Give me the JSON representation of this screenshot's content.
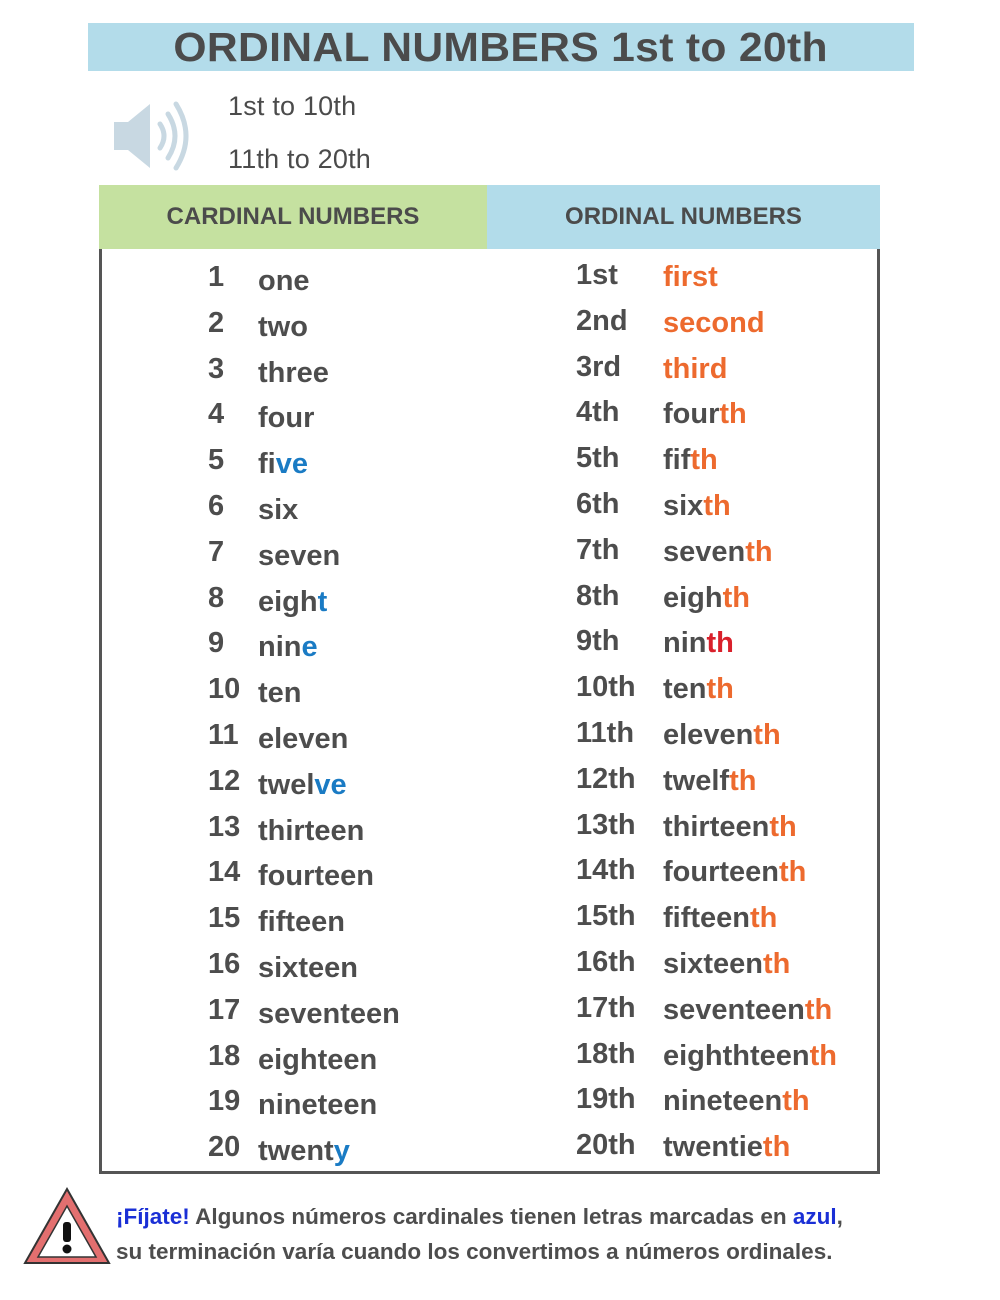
{
  "title": "ORDINAL NUMBERS 1st to 20th",
  "audio": {
    "icon": "speaker-icon",
    "links": [
      "1st to 10th",
      "11th to 20th"
    ]
  },
  "table": {
    "headers": {
      "cardinal": "CARDINAL NUMBERS",
      "ordinal": "ORDINAL NUMBERS"
    },
    "header_colors": {
      "cardinal": "#c5e1a0",
      "ordinal": "#b2dcea"
    },
    "highlight_colors": {
      "blue": "#1a7bc4",
      "orange": "#ed6a2e",
      "red": "#d9202b"
    },
    "rows": [
      {
        "c_num": "1",
        "c_base": "one",
        "c_hl": "",
        "o_num": "1st",
        "o_base": "",
        "o_hl": "first",
        "o_hl_color": "orange"
      },
      {
        "c_num": "2",
        "c_base": "two",
        "c_hl": "",
        "o_num": "2nd",
        "o_base": "",
        "o_hl": "second",
        "o_hl_color": "orange"
      },
      {
        "c_num": "3",
        "c_base": "three",
        "c_hl": "",
        "o_num": "3rd",
        "o_base": "",
        "o_hl": "third",
        "o_hl_color": "orange"
      },
      {
        "c_num": "4",
        "c_base": "four",
        "c_hl": "",
        "o_num": "4th",
        "o_base": "four",
        "o_hl": "th",
        "o_hl_color": "orange"
      },
      {
        "c_num": "5",
        "c_base": "fi",
        "c_hl": "ve",
        "o_num": "5th",
        "o_base": "fif",
        "o_hl": "th",
        "o_hl_color": "orange"
      },
      {
        "c_num": "6",
        "c_base": "six",
        "c_hl": "",
        "o_num": "6th",
        "o_base": "six",
        "o_hl": "th",
        "o_hl_color": "orange"
      },
      {
        "c_num": "7",
        "c_base": "seven",
        "c_hl": "",
        "o_num": "7th",
        "o_base": "seven",
        "o_hl": "th",
        "o_hl_color": "orange"
      },
      {
        "c_num": "8",
        "c_base": "eigh",
        "c_hl": "t",
        "o_num": "8th",
        "o_base": "eigh",
        "o_hl": "th",
        "o_hl_color": "orange"
      },
      {
        "c_num": "9",
        "c_base": "nin",
        "c_hl": "e",
        "o_num": "9th",
        "o_base": "nin",
        "o_hl": "th",
        "o_hl_color": "red"
      },
      {
        "c_num": "10",
        "c_base": "ten",
        "c_hl": "",
        "o_num": "10th",
        "o_base": "ten",
        "o_hl": "th",
        "o_hl_color": "orange"
      },
      {
        "c_num": "11",
        "c_base": "eleven",
        "c_hl": "",
        "o_num": "11th",
        "o_base": "eleven",
        "o_hl": "th",
        "o_hl_color": "orange"
      },
      {
        "c_num": "12",
        "c_base": "twel",
        "c_hl": "ve",
        "o_num": "12th",
        "o_base": "twelf",
        "o_hl": "th",
        "o_hl_color": "orange"
      },
      {
        "c_num": "13",
        "c_base": "thirteen",
        "c_hl": "",
        "o_num": "13th",
        "o_base": "thirteen",
        "o_hl": "th",
        "o_hl_color": "orange"
      },
      {
        "c_num": "14",
        "c_base": "fourteen",
        "c_hl": "",
        "o_num": "14th",
        "o_base": "fourteen",
        "o_hl": "th",
        "o_hl_color": "orange"
      },
      {
        "c_num": "15",
        "c_base": "fifteen",
        "c_hl": "",
        "o_num": "15th",
        "o_base": "fifteen",
        "o_hl": "th",
        "o_hl_color": "orange"
      },
      {
        "c_num": "16",
        "c_base": "sixteen",
        "c_hl": "",
        "o_num": "16th",
        "o_base": "sixteen",
        "o_hl": "th",
        "o_hl_color": "orange"
      },
      {
        "c_num": "17",
        "c_base": "seventeen",
        "c_hl": "",
        "o_num": "17th",
        "o_base": "seventeen",
        "o_hl": "th",
        "o_hl_color": "orange"
      },
      {
        "c_num": "18",
        "c_base": "eighteen",
        "c_hl": "",
        "o_num": "18th",
        "o_base": "eighthteen",
        "o_hl": "th",
        "o_hl_color": "orange"
      },
      {
        "c_num": "19",
        "c_base": "nineteen",
        "c_hl": "",
        "o_num": "19th",
        "o_base": "nineteen",
        "o_hl": "th",
        "o_hl_color": "orange"
      },
      {
        "c_num": "20",
        "c_base": "twent",
        "c_hl": "y",
        "o_num": "20th",
        "o_base": "twentie",
        "o_hl": "th",
        "o_hl_color": "orange"
      }
    ]
  },
  "note": {
    "icon": "warning-icon",
    "lead": "¡Fíjate!",
    "text_before": " Algunos números cardinales tienen letras marcadas en ",
    "highlight": "azul",
    "text_after": ",",
    "line2": "su terminación varía cuando los convertimos a números ordinales.",
    "lead_color": "#1a2fd6"
  }
}
